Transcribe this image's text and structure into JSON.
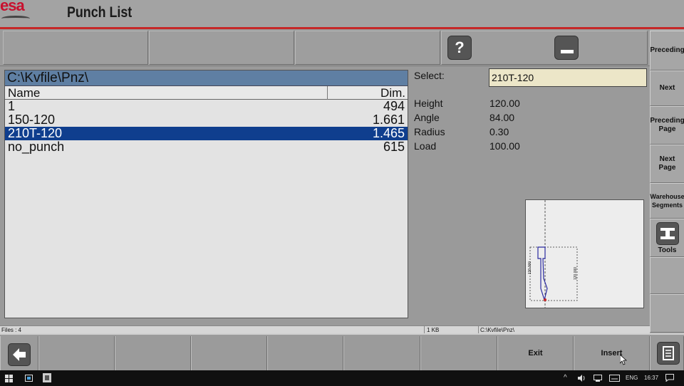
{
  "app": {
    "logo": "esa",
    "title": "Punch List"
  },
  "toolbar_top": {
    "help_icon": "question-mark-icon",
    "minimize_icon": "minimize-icon",
    "help_glyph": "?"
  },
  "sidebar": {
    "preceding": "Preceding",
    "next": "Next",
    "preceding_page": "Preceding Page",
    "next_page": "Next Page",
    "warehouse_segments": "Warehouse Segments",
    "tools": "Tools"
  },
  "file_list": {
    "path": "C:\\Kvfile\\Pnz\\",
    "columns": {
      "name": "Name",
      "dim": "Dim."
    },
    "rows": [
      {
        "name": "1",
        "dim": "494",
        "selected": false
      },
      {
        "name": "150-120",
        "dim": "1.661",
        "selected": false
      },
      {
        "name": "210T-120",
        "dim": "1.465",
        "selected": true
      },
      {
        "name": "no_punch",
        "dim": "615",
        "selected": false
      }
    ]
  },
  "details": {
    "select_label": "Select:",
    "select_value": "210T-120",
    "fields": [
      {
        "label": "Height",
        "value": "120.00"
      },
      {
        "label": "Angle",
        "value": "84.00"
      },
      {
        "label": "Radius",
        "value": "0.30"
      },
      {
        "label": "Load",
        "value": "100.00"
      }
    ]
  },
  "preview": {
    "dim_left": "120.000",
    "dim_right": "120.000"
  },
  "status": {
    "files": "Files : 4",
    "size": "1 KB",
    "path": "C:\\Kvfile\\Pnz\\"
  },
  "toolbar_bottom": {
    "exit": "Exit",
    "insert": "Insert"
  },
  "taskbar": {
    "lang": "ENG",
    "time": "16:37"
  },
  "colors": {
    "accent_red": "#c62828",
    "selection_blue": "#0f3e8e",
    "path_header": "#5f7fa3",
    "select_field": "#ece6c8"
  }
}
